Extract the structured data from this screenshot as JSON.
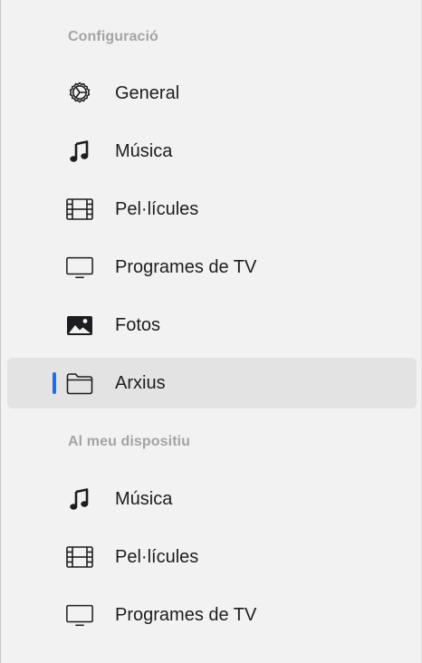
{
  "colors": {
    "background": "#f2f2f2",
    "selected_background": "#e3e3e3",
    "selection_indicator": "#1d6cf2",
    "section_header": "#a4a4a4",
    "label": "#1d1d1f"
  },
  "sections": [
    {
      "header": "Configuració",
      "items": [
        {
          "label": "General",
          "icon": "gear-icon",
          "selected": false
        },
        {
          "label": "Música",
          "icon": "music-note-icon",
          "selected": false
        },
        {
          "label": "Pel·lícules",
          "icon": "film-icon",
          "selected": false
        },
        {
          "label": "Programes de TV",
          "icon": "tv-icon",
          "selected": false
        },
        {
          "label": "Fotos",
          "icon": "photo-icon",
          "selected": false
        },
        {
          "label": "Arxius",
          "icon": "folder-icon",
          "selected": true
        }
      ]
    },
    {
      "header": "Al meu dispositiu",
      "items": [
        {
          "label": "Música",
          "icon": "music-note-icon",
          "selected": false
        },
        {
          "label": "Pel·lícules",
          "icon": "film-icon",
          "selected": false
        },
        {
          "label": "Programes de TV",
          "icon": "tv-icon",
          "selected": false
        }
      ]
    }
  ]
}
